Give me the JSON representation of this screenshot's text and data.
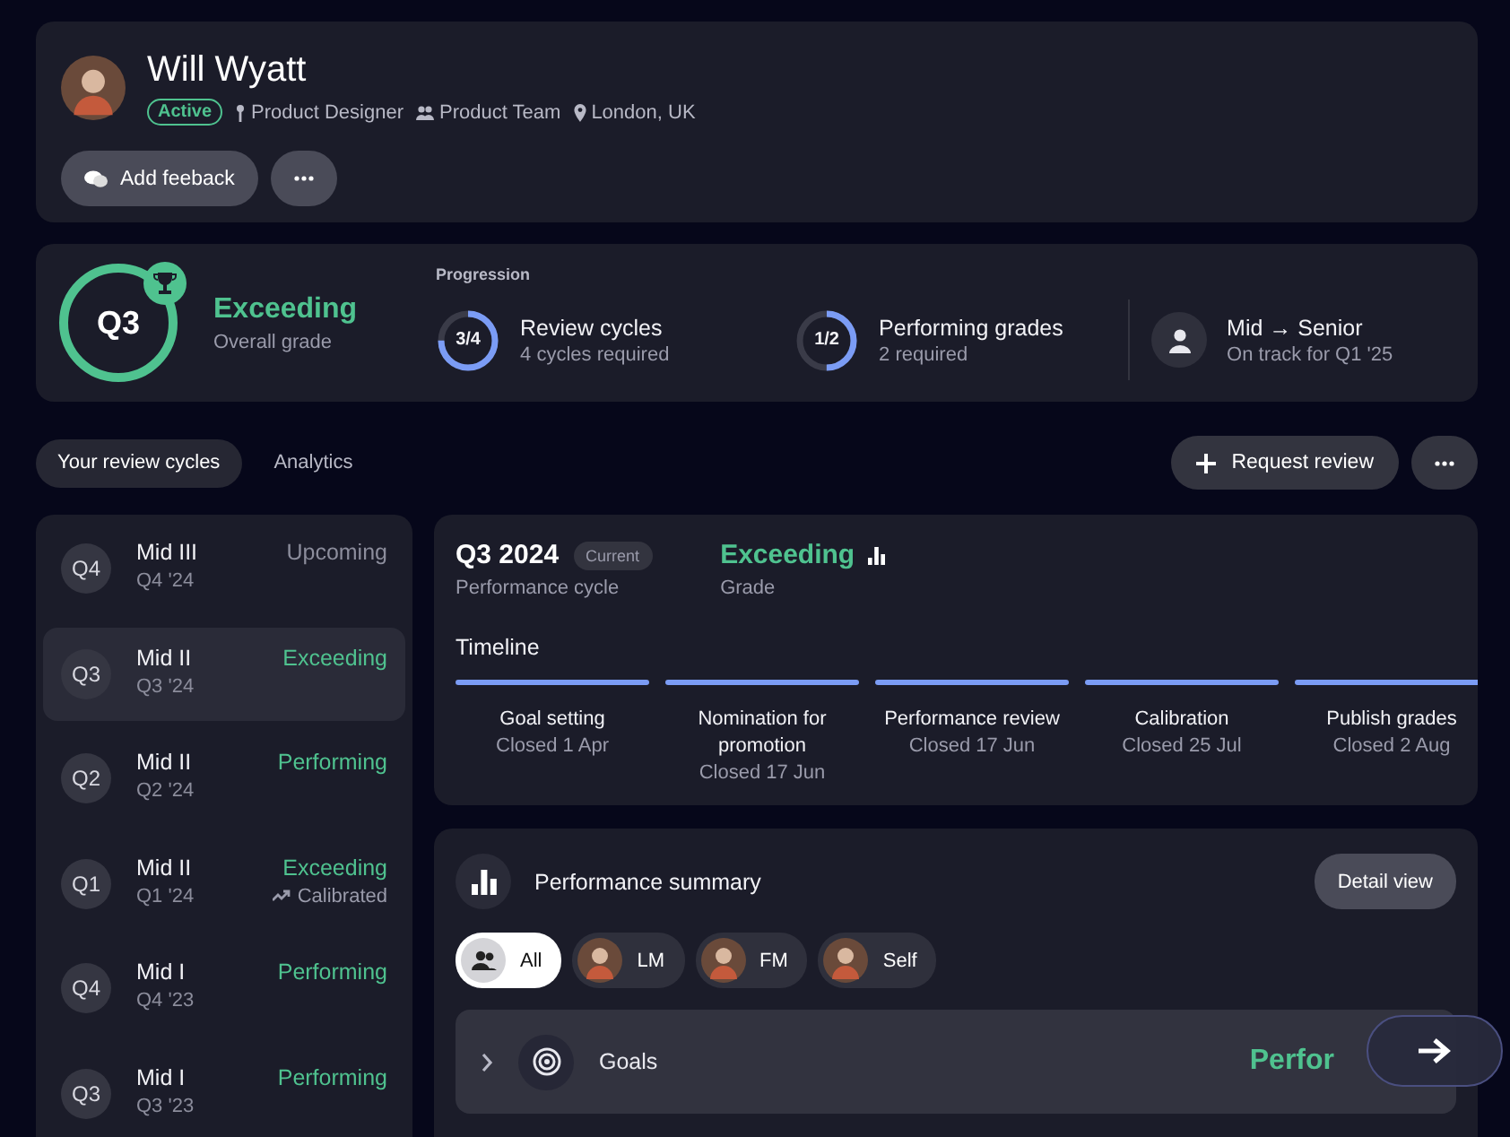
{
  "profile": {
    "name": "Will Wyatt",
    "status": "Active",
    "meta": [
      {
        "kind": "role",
        "text": "Product Designer"
      },
      {
        "kind": "team",
        "text": "Product Team"
      },
      {
        "kind": "location",
        "text": "London, UK"
      }
    ],
    "buttons": [
      {
        "kind": "feedback",
        "label": "Add feeback"
      },
      {
        "kind": "more"
      }
    ]
  },
  "overall": {
    "quarter": "Q3",
    "grade": "Exceeding",
    "caption": "Overall grade"
  },
  "progression": {
    "title": "Progression",
    "items": [
      {
        "kind": "ring",
        "count": "3/4",
        "level": 0.75,
        "title": "Review cycles",
        "subtitle": "4 cycles required"
      },
      {
        "kind": "ring",
        "count": "1/2",
        "level": 0.5,
        "title": "Performing grades",
        "subtitle": "2 required"
      },
      {
        "kind": "person",
        "title": "Mid → Senior",
        "subtitle": "On track for Q1 '25"
      }
    ]
  },
  "tabs": [
    {
      "label": "Your review cycles",
      "selected": true
    },
    {
      "label": "Analytics",
      "selected": false
    }
  ],
  "actions": [
    {
      "kind": "add",
      "label": "Request review"
    },
    {
      "kind": "more"
    }
  ],
  "cycles": [
    {
      "quarter": "Q4",
      "title": "Mid III",
      "date": "Q4 '24",
      "grade": "Upcoming",
      "upcoming": true,
      "selected": false
    },
    {
      "quarter": "Q3",
      "title": "Mid II",
      "date": "Q3 '24",
      "grade": "Exceeding",
      "upcoming": false,
      "selected": true
    },
    {
      "quarter": "Q2",
      "title": "Mid II",
      "date": "Q2 '24",
      "grade": "Performing",
      "upcoming": false,
      "selected": false
    },
    {
      "quarter": "Q1",
      "title": "Mid II",
      "date": "Q1 '24",
      "grade": "Exceeding",
      "upcoming": false,
      "note": "Calibrated",
      "selected": false
    },
    {
      "quarter": "Q4",
      "title": "Mid I",
      "date": "Q4 '23",
      "grade": "Performing",
      "upcoming": false,
      "selected": false
    },
    {
      "quarter": "Q3",
      "title": "Mid I",
      "date": "Q3 '23",
      "grade": "Performing",
      "upcoming": false,
      "selected": false
    }
  ],
  "current_cycle": {
    "title": "Q3 2024",
    "badge": "Current",
    "subtitle": "Performance cycle",
    "grade": "Exceeding",
    "grade_caption": "Grade",
    "timeline_title": "Timeline",
    "steps": [
      {
        "label": "Goal setting",
        "date": "Closed 1 Apr",
        "done": true
      },
      {
        "label": "Nomination for promotion",
        "date": "Closed 17 Jun",
        "done": true
      },
      {
        "label": "Performance review",
        "date": "Closed 17 Jun",
        "done": true
      },
      {
        "label": "Calibration",
        "date": "Closed 25 Jul",
        "done": true
      },
      {
        "label": "Publish grades",
        "date": "Closed 2 Aug",
        "done": true
      }
    ]
  },
  "summary": {
    "title": "Performance summary",
    "button": "Detail view",
    "filters": [
      {
        "kind": "group",
        "label": "All",
        "selected": true
      },
      {
        "kind": "person",
        "label": "LM",
        "selected": false
      },
      {
        "kind": "person",
        "label": "FM",
        "selected": false
      },
      {
        "kind": "person",
        "label": "Self",
        "selected": false
      }
    ],
    "rows": [
      {
        "label": "Goals",
        "grade": "Perfor",
        "expanded": false
      }
    ]
  }
}
